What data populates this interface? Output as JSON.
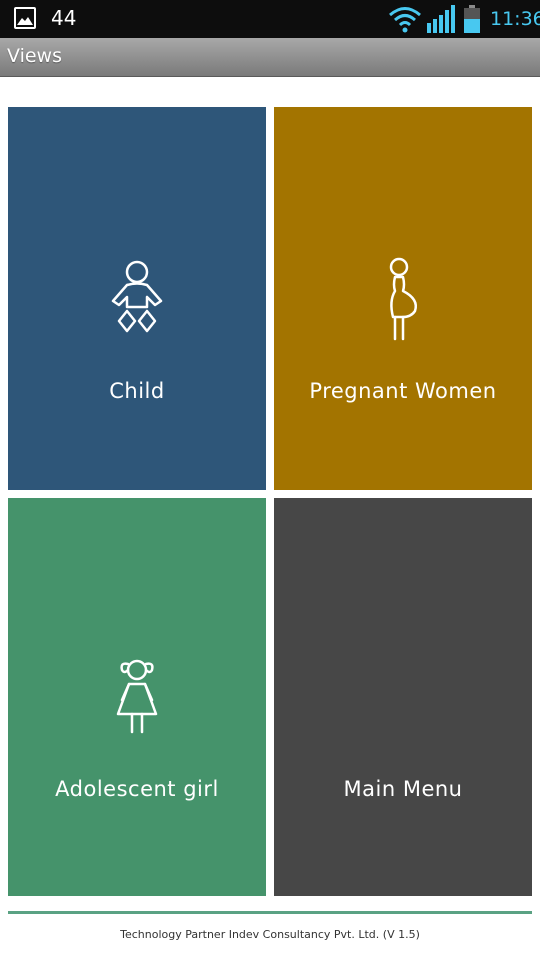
{
  "status_bar": {
    "notification_count": "44",
    "time": "11:36",
    "icons": [
      "gallery-icon",
      "wifi-icon",
      "signal-icon",
      "battery-icon"
    ]
  },
  "action_bar": {
    "title": "Views"
  },
  "tiles": [
    {
      "label": "Child",
      "icon": "baby-icon",
      "color": "#2e5679"
    },
    {
      "label": "Pregnant Women",
      "icon": "pregnant-woman-icon",
      "color": "#a37400"
    },
    {
      "label": "Adolescent girl",
      "icon": "girl-icon",
      "color": "#45936b"
    },
    {
      "label": "Main Menu",
      "icon": "",
      "color": "#474747"
    }
  ],
  "footer": {
    "text": "Technology Partner Indev Consultancy Pvt. Ltd. (V 1.5)",
    "line_color": "#5aa283"
  }
}
